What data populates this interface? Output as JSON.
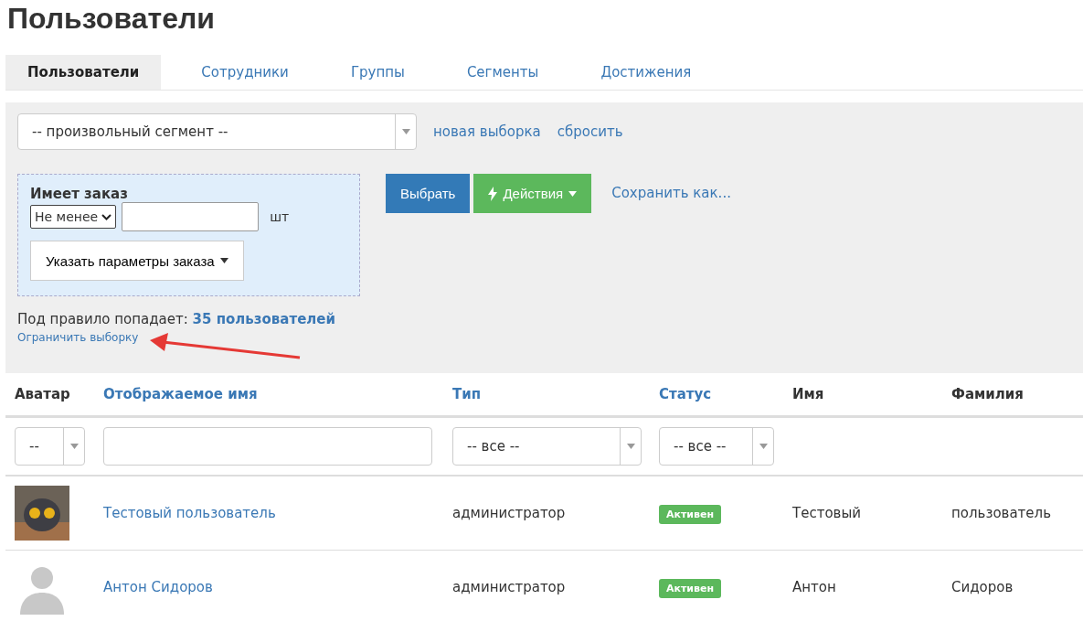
{
  "page_title": "Пользователи",
  "tabs": [
    {
      "label": "Пользователи",
      "selected": true
    },
    {
      "label": "Сотрудники",
      "selected": false
    },
    {
      "label": "Группы",
      "selected": false
    },
    {
      "label": "Сегменты",
      "selected": false
    },
    {
      "label": "Достижения",
      "selected": false
    }
  ],
  "filter": {
    "segment_select": "-- произвольный сегмент --",
    "links": [
      "новая выборка",
      "сбросить"
    ],
    "condition": {
      "title": "Имеет заказ",
      "comparison": "Не менее",
      "unit": "шт",
      "params_button": "Указать параметры заказа"
    },
    "buttons": {
      "select": "Выбрать",
      "actions": "Действия",
      "save": "Сохранить как..."
    },
    "match_text": "Под правило попадает:",
    "match_count": "35 пользователей",
    "limit_link": "Ограничить выборку"
  },
  "table": {
    "columns": [
      {
        "label": "Аватар",
        "sortable": false
      },
      {
        "label": "Отображаемое имя",
        "sortable": true
      },
      {
        "label": "Тип",
        "sortable": true
      },
      {
        "label": "Статус",
        "sortable": true
      },
      {
        "label": "Имя",
        "sortable": false
      },
      {
        "label": "Фамилия",
        "sortable": false
      }
    ],
    "filters": {
      "avatar": "--",
      "type": "-- все --",
      "status": "-- все --"
    },
    "rows": [
      {
        "kind": "photo",
        "display_name": "Тестовый пользователь",
        "type": "администратор",
        "status": "Активен",
        "first_name": "Тестовый",
        "last_name": "пользователь"
      },
      {
        "kind": "silhouette",
        "display_name": "Антон Сидоров",
        "type": "администратор",
        "status": "Активен",
        "first_name": "Антон",
        "last_name": "Сидоров"
      }
    ]
  }
}
